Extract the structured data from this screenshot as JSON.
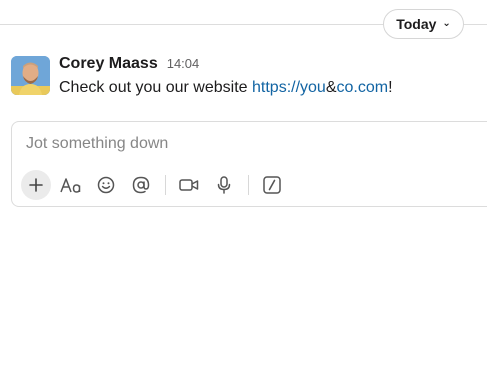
{
  "date_divider": {
    "label": "Today"
  },
  "message": {
    "sender": "Corey Maass",
    "time": "14:04",
    "text_prefix": "Check out you our website ",
    "link_part1": "https://you",
    "link_amp": "&",
    "link_part2": "co.com",
    "text_suffix": "!"
  },
  "composer": {
    "placeholder": "Jot something down",
    "toolbar": [
      "plus-icon",
      "text-format-icon",
      "emoji-icon",
      "mention-icon",
      "video-icon",
      "microphone-icon",
      "slash-command-icon"
    ]
  },
  "colors": {
    "link": "#1264a3",
    "text": "#1d1c1d",
    "muted": "#868686",
    "border": "#dcdcdc"
  }
}
